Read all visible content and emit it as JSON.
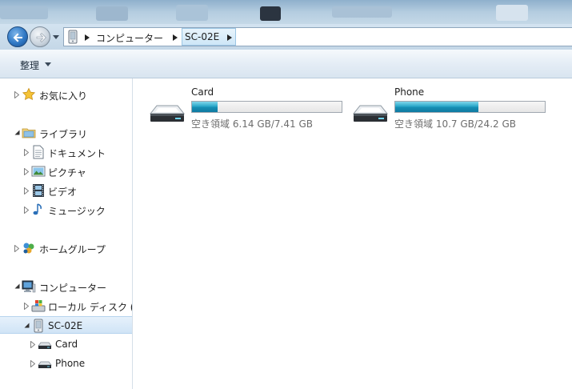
{
  "address": {
    "breadcrumbs": [
      "コンピューター",
      "SC-02E"
    ]
  },
  "toolbar": {
    "organize_label": "整理"
  },
  "nav": {
    "favorites": "お気に入り",
    "libraries": "ライブラリ",
    "documents": "ドキュメント",
    "pictures": "ピクチャ",
    "videos": "ビデオ",
    "music": "ミュージック",
    "homegroup": "ホームグループ",
    "computer": "コンピューター",
    "local_disk": "ローカル ディスク (",
    "device": "SC-02E",
    "card": "Card",
    "phone": "Phone"
  },
  "drives": [
    {
      "name": "Card",
      "free_text": "空き領域 6.14 GB/7.41 GB",
      "used_fraction": 0.171
    },
    {
      "name": "Phone",
      "free_text": "空き領域 10.7 GB/24.2 GB",
      "used_fraction": 0.558
    }
  ],
  "colors": {
    "accent": "#2aa7c9",
    "selection": "#d0e4f6"
  }
}
